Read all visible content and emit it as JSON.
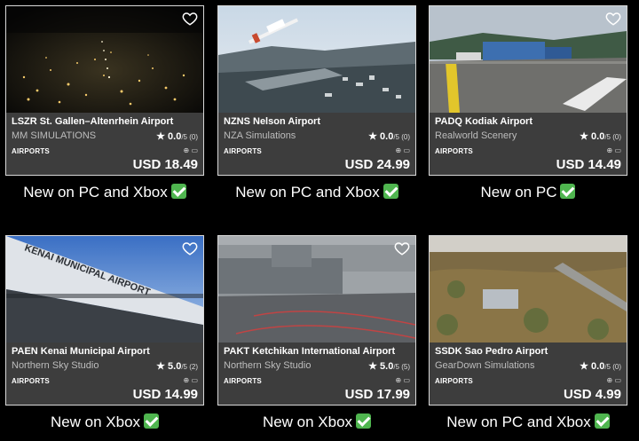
{
  "products": [
    {
      "title": "LSZR St. Gallen–Altenrhein Airport",
      "studio": "MM SIMULATIONS",
      "rating": "0.0",
      "rating_suffix": "/5 (0)",
      "category": "AIRPORTS",
      "platforms": "⊕ ▭",
      "price": "USD 18.49",
      "caption": "New on PC and Xbox",
      "scene": "night-city"
    },
    {
      "title": "NZNS Nelson Airport",
      "studio": "NZA Simulations",
      "rating": "0.0",
      "rating_suffix": "/5 (0)",
      "category": "AIRPORTS",
      "platforms": "⊕ ▭",
      "price": "USD 24.99",
      "caption": "New on PC and Xbox",
      "scene": "plane-town"
    },
    {
      "title": "PADQ Kodiak Airport",
      "studio": "Realworld Scenery",
      "rating": "0.0",
      "rating_suffix": "/5 (0)",
      "category": "AIRPORTS",
      "platforms": "⊕ ▭",
      "price": "USD 14.49",
      "caption": "New on PC",
      "scene": "hangar-runway"
    },
    {
      "title": "PAEN Kenai Municipal Airport",
      "studio": "Northern Sky Studio",
      "rating": "5.0",
      "rating_suffix": "/5 (2)",
      "category": "AIRPORTS",
      "platforms": "⊕ ▭",
      "price": "USD 14.99",
      "caption": "New on Xbox",
      "scene": "kenai-sign",
      "sign_text": "KENAI MUNICIPAL AIRPORT"
    },
    {
      "title": "PAKT Ketchikan International Airport",
      "studio": "Northern Sky Studio",
      "rating": "5.0",
      "rating_suffix": "/5 (5)",
      "category": "AIRPORTS",
      "platforms": "⊕ ▭",
      "price": "USD 17.99",
      "caption": "New on Xbox",
      "scene": "terminal-rain"
    },
    {
      "title": "SSDK Sao Pedro Airport",
      "studio": "GearDown Simulations",
      "rating": "0.0",
      "rating_suffix": "/5 (0)",
      "category": "AIRPORTS",
      "platforms": "⊕ ▭",
      "price": "USD 4.99",
      "caption": "New on PC and Xbox",
      "scene": "aerial-hills"
    }
  ],
  "icons": {
    "favorite": "heart-icon",
    "star": "star-icon",
    "rating_star": "★",
    "check": "check-icon"
  },
  "colors": {
    "card_info_bg": "#3d3d3d",
    "check_green": "#4fb54f",
    "background": "#000000"
  }
}
